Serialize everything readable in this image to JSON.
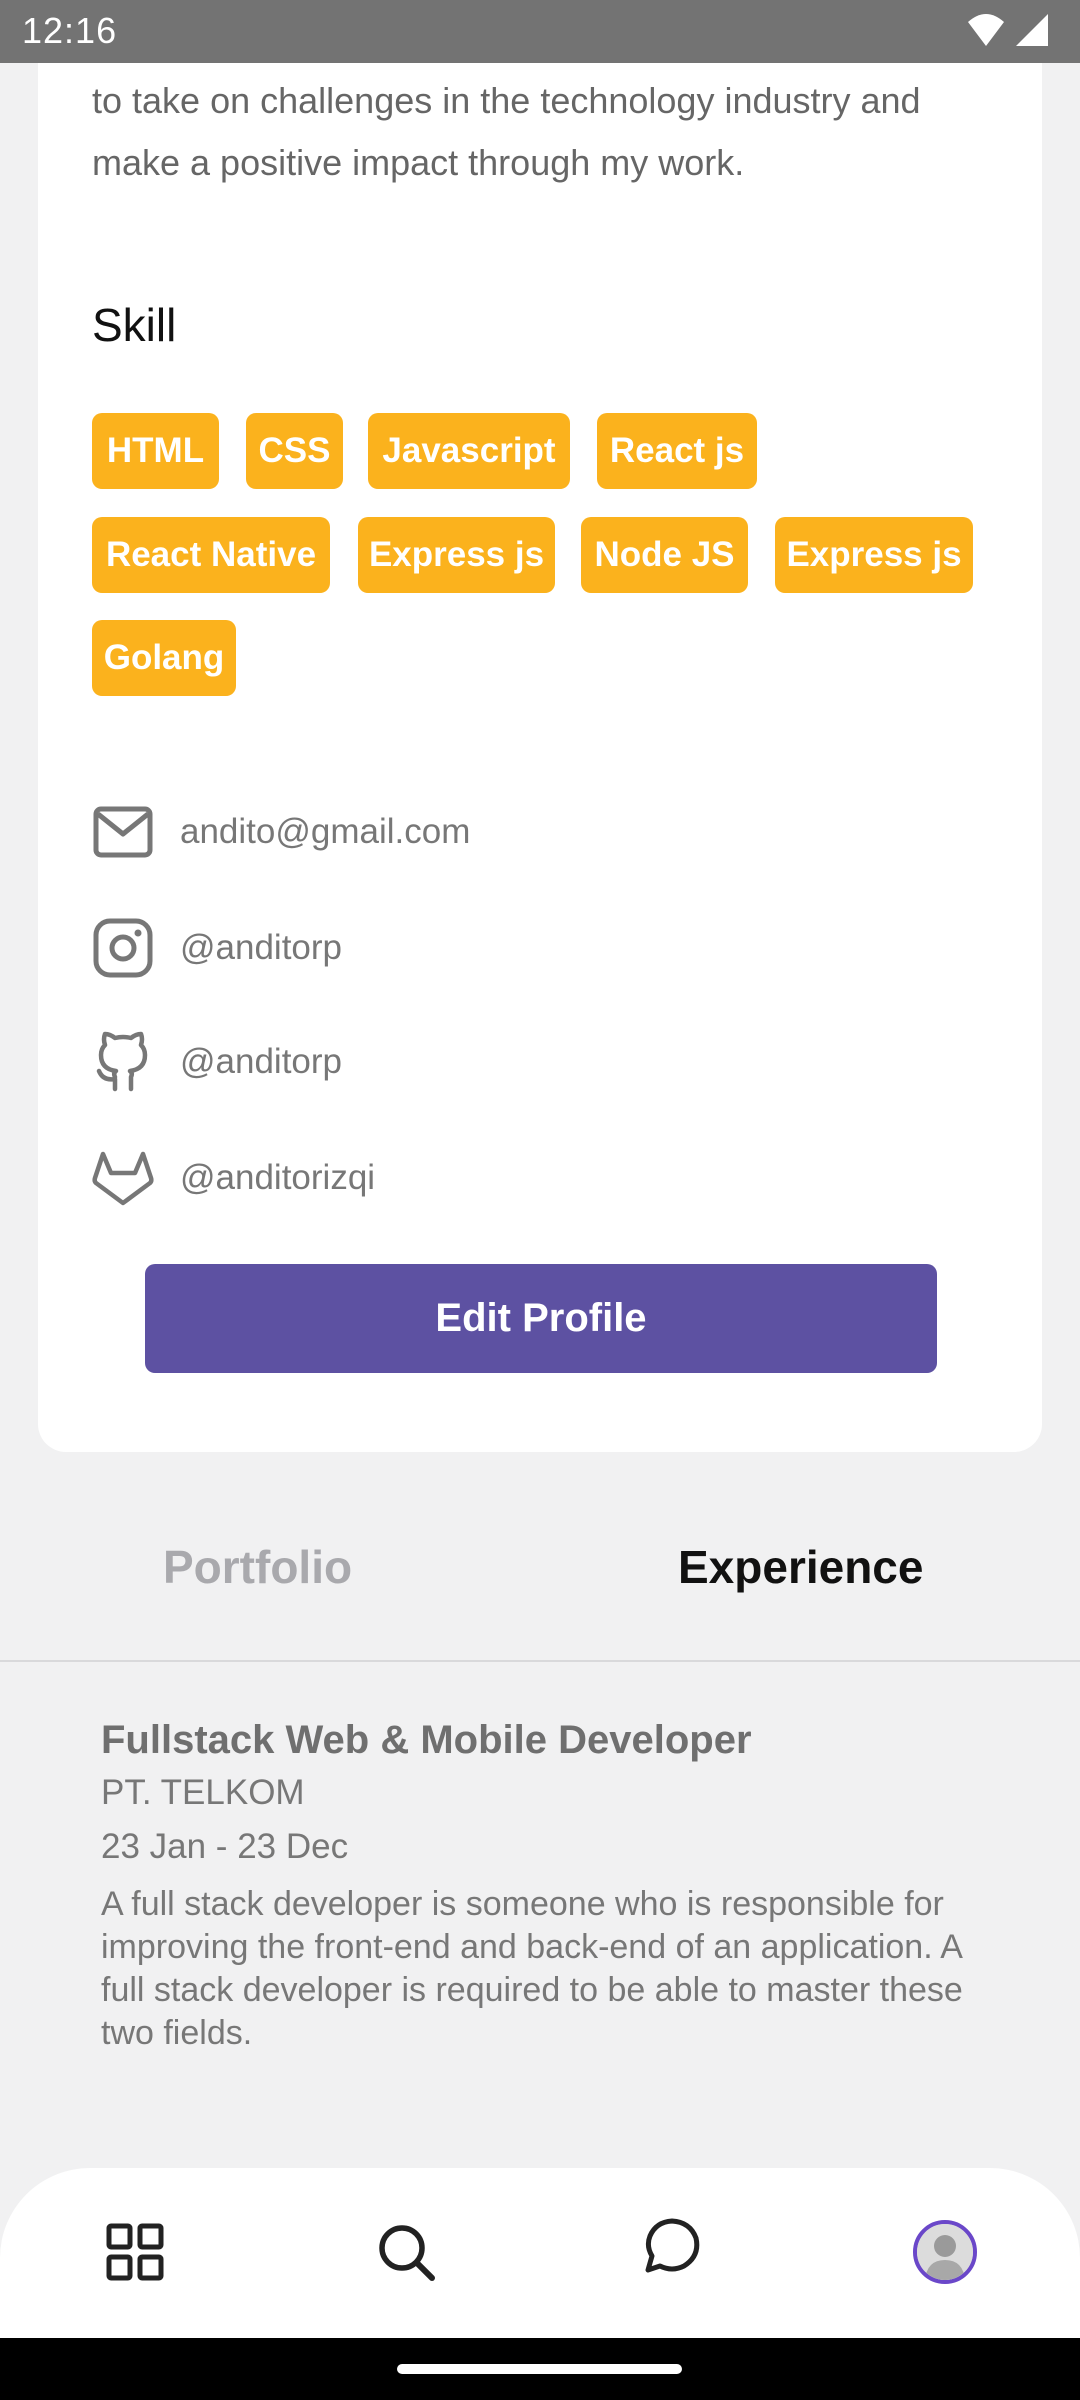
{
  "status_bar": {
    "time": "12:16"
  },
  "about": {
    "text": "to take on challenges in the technology industry and make a positive impact through my work."
  },
  "skills": {
    "title": "Skill",
    "items": [
      "HTML",
      "CSS",
      "Javascript",
      "React js",
      "React Native",
      "Express js",
      "Node JS",
      "Express js",
      "Golang"
    ]
  },
  "contacts": {
    "email": "andito@gmail.com",
    "instagram": "@anditorp",
    "github": "@anditorp",
    "gitlab": "@anditorizqi"
  },
  "edit_button": "Edit Profile",
  "tabs": {
    "portfolio": "Portfolio",
    "experience": "Experience"
  },
  "experience": {
    "role": "Fullstack Web & Mobile Developer",
    "company": "PT. TELKOM",
    "date": "23 Jan - 23 Dec",
    "description": "A full stack developer is someone who is responsible for improving the front-end and back-end of an application. A full stack developer is required to be able to master these two fields."
  },
  "colors": {
    "accent": "#5d51a2",
    "chip": "#fbb21d",
    "avatar_ring": "#6a47c9"
  },
  "bottom_nav": {
    "items": [
      "grid-icon",
      "search-icon",
      "chat-icon",
      "profile-avatar"
    ]
  }
}
